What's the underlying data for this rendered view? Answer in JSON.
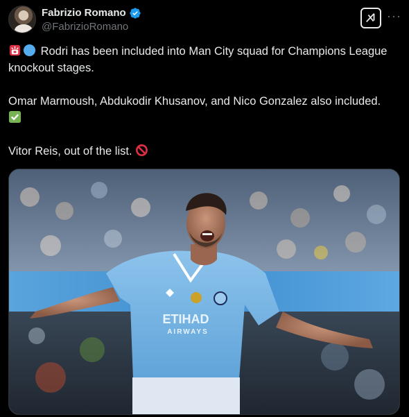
{
  "author": {
    "display_name": "Fabrizio Romano",
    "handle": "@FabrizioRomano",
    "verified": true,
    "avatar_icon": "avatar-photo"
  },
  "actions": {
    "grok_icon": "grok-icon",
    "more_icon": "more-options-icon"
  },
  "tweet": {
    "line1_emojis": [
      "siren-emoji",
      "blue-circle-emoji"
    ],
    "line1_text": "Rodri has been included into Man City squad for Champions League knockout stages.",
    "line2_text": "Omar Marmoush, Abdukodir Khusanov, and Nico Gonzalez also included.",
    "line2_emoji": "check-mark-emoji",
    "line3_text": "Vitor Reis, out of the list.",
    "line3_emoji": "prohibited-emoji"
  },
  "media": {
    "jersey_sponsor": "ETIHAD",
    "jersey_sponsor_sub": "AIRWAYS",
    "colors": {
      "sky_blue": "#6cabdd",
      "verified_blue": "#1d9bf0"
    }
  }
}
